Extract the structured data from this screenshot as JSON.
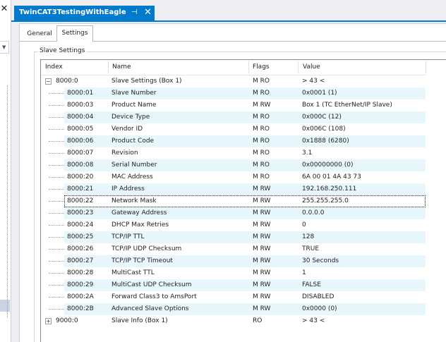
{
  "window": {
    "title": "TwinCAT3TestingWithEagle",
    "pin_glyph": "⊣",
    "close_glyph": "✕",
    "left_close_glyph": "✕"
  },
  "tabs": [
    {
      "label": "General"
    },
    {
      "label": "Settings"
    }
  ],
  "group": {
    "title": "Slave Settings"
  },
  "columns": {
    "index": "Index",
    "name": "Name",
    "flags": "Flags",
    "value": "Value"
  },
  "rows": [
    {
      "index": "8000:0",
      "name": "Slave Settings (Box 1)",
      "flags": "M RO",
      "value": "> 43 <",
      "group": true,
      "expanded": true
    },
    {
      "index": "8000:01",
      "name": "Slave Number",
      "flags": "M RO",
      "value": "0x0001 (1)"
    },
    {
      "index": "8000:03",
      "name": "Product Name",
      "flags": "M RW",
      "value": "Box 1 (TC EtherNet/IP Slave)"
    },
    {
      "index": "8000:04",
      "name": "Device Type",
      "flags": "M RO",
      "value": "0x000C (12)"
    },
    {
      "index": "8000:05",
      "name": "Vendor ID",
      "flags": "M RO",
      "value": "0x006C (108)"
    },
    {
      "index": "8000:06",
      "name": "Product Code",
      "flags": "M RO",
      "value": "0x1888 (6280)"
    },
    {
      "index": "8000:07",
      "name": "Revision",
      "flags": "M RO",
      "value": "3.1"
    },
    {
      "index": "8000:08",
      "name": "Serial Number",
      "flags": "M RO",
      "value": "0x00000000 (0)"
    },
    {
      "index": "8000:20",
      "name": "MAC Address",
      "flags": "M RO",
      "value": "6A 00 01 4A 43 73"
    },
    {
      "index": "8000:21",
      "name": "IP Address",
      "flags": "M RW",
      "value": "192.168.250.111"
    },
    {
      "index": "8000:22",
      "name": "Network Mask",
      "flags": "M RW",
      "value": "255.255.255.0",
      "selected": true
    },
    {
      "index": "8000:23",
      "name": "Gateway Address",
      "flags": "M RW",
      "value": "0.0.0.0"
    },
    {
      "index": "8000:24",
      "name": "DHCP Max Retries",
      "flags": "M RW",
      "value": "0"
    },
    {
      "index": "8000:25",
      "name": "TCP/IP TTL",
      "flags": "M RW",
      "value": "128"
    },
    {
      "index": "8000:26",
      "name": "TCP/IP UDP Checksum",
      "flags": "M RW",
      "value": "TRUE"
    },
    {
      "index": "8000:27",
      "name": "TCP/IP TCP Timeout",
      "flags": "M RW",
      "value": "30 Seconds"
    },
    {
      "index": "8000:28",
      "name": "MultiCast TTL",
      "flags": "M RW",
      "value": "1"
    },
    {
      "index": "8000:29",
      "name": "MultiCast UDP Checksum",
      "flags": "M RW",
      "value": "FALSE"
    },
    {
      "index": "8000:2A",
      "name": "Forward Class3 to AmsPort",
      "flags": "M RW",
      "value": "DISABLED"
    },
    {
      "index": "8000:2B",
      "name": "Advanced Slave Options",
      "flags": "M RW",
      "value": "0x0000 (0)"
    },
    {
      "index": "9000:0",
      "name": "Slave Info (Box 1)",
      "flags": "RO",
      "value": "> 43 <",
      "group": true,
      "expanded": false
    }
  ],
  "colors": {
    "accent": "#007acc",
    "row_alt": "#e8f7fb"
  }
}
